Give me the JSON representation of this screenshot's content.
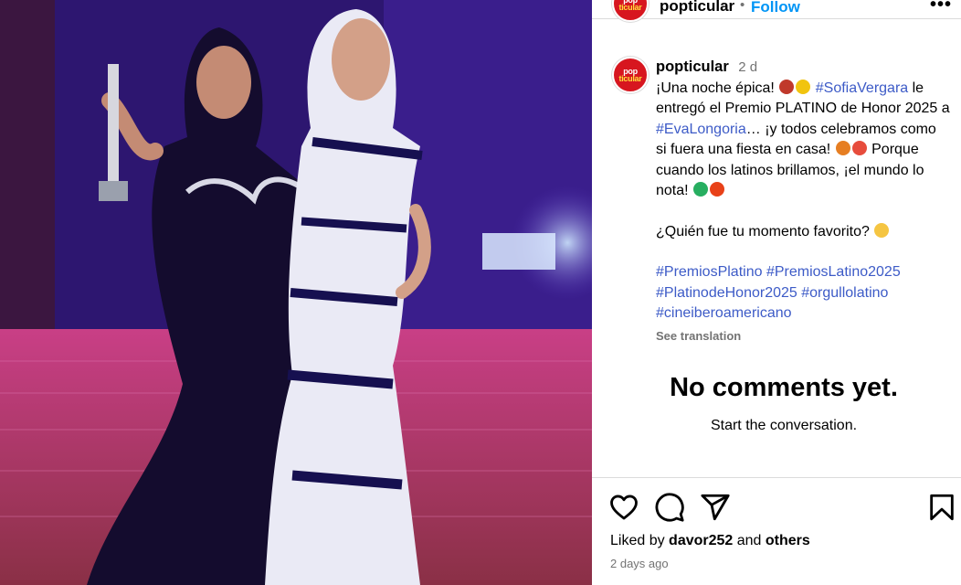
{
  "post": {
    "username": "popticular",
    "follow_label": "Follow",
    "dot": "•",
    "more_label": "•••",
    "avatar_logo_top": "pop",
    "avatar_logo_bottom": "ticular"
  },
  "caption": {
    "username": "popticular",
    "time": "2 d",
    "line1_a": "¡Una noche épica! ",
    "hashtag_sofia": "#SofiaVergara",
    "line1_b": " le entregó el Premio PLATINO de Honor 2025 a ",
    "hashtag_eva": "#EvaLongoria",
    "line1_c": "… ¡y todos celebramos como si fuera una fiesta en casa! ",
    "line1_d": " Porque cuando los latinos brillamos, ¡el mundo lo nota! ",
    "question": "¿Quién fue tu momento favorito? ",
    "hashtags": [
      "#PremiosPlatino",
      "#PremiosLatino2025",
      "#PlatinodeHonor2025",
      "#orgullolatino",
      "#cineiberoamericano"
    ],
    "see_translation": "See translation"
  },
  "comments": {
    "empty_title": "No comments yet.",
    "empty_subtitle": "Start the conversation."
  },
  "footer": {
    "liked_prefix": "Liked by ",
    "liked_user": "davor252",
    "liked_and": " and ",
    "liked_others": "others",
    "posted": "2 days ago"
  },
  "colors": {
    "follow": "#0095f6",
    "hashtag": "#3d5bc7",
    "secondary_text": "#737373",
    "brand_red": "#d7161f"
  },
  "icons": [
    "heart-icon",
    "comment-icon",
    "share-icon",
    "bookmark-icon",
    "more-options-icon"
  ]
}
